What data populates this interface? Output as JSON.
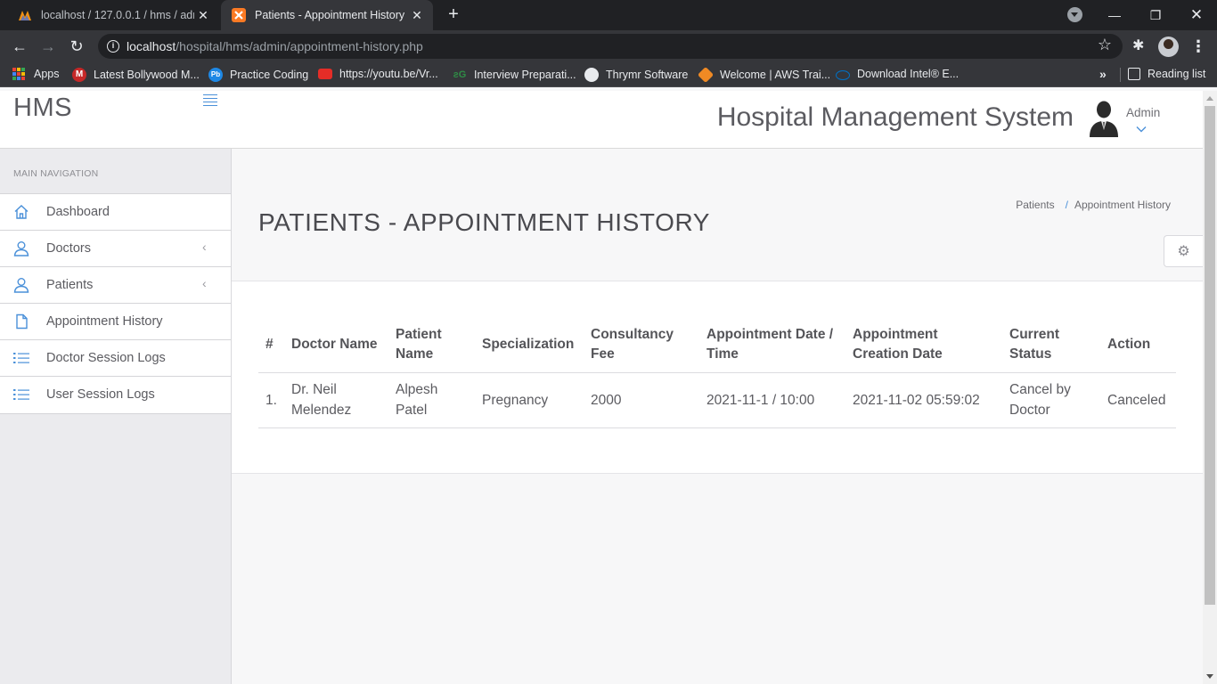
{
  "browser": {
    "tabs": [
      {
        "title": "localhost / 127.0.0.1 / hms / adm",
        "active": false
      },
      {
        "title": "Patients - Appointment History",
        "active": true
      }
    ],
    "url_host": "localhost",
    "url_path": "/hospital/hms/admin/appointment-history.php",
    "bookmarks": [
      {
        "label": "Apps",
        "icon": "apps-grid-icon"
      },
      {
        "label": "Latest Bollywood M...",
        "icon": "music-m-icon",
        "color": "#c62828"
      },
      {
        "label": "Practice Coding",
        "icon": "pb-icon",
        "color": "#1e88e5"
      },
      {
        "label": "https://youtu.be/Vr...",
        "icon": "youtube-icon",
        "color": "#e52d27"
      },
      {
        "label": "Interview Preparati...",
        "icon": "gfg-icon",
        "color": "#2f8d46"
      },
      {
        "label": "Thrymr Software",
        "icon": "globe-icon",
        "color": "#e8eaed"
      },
      {
        "label": "Welcome | AWS Trai...",
        "icon": "aws-icon",
        "color": "#f08a24"
      },
      {
        "label": "Download Intel® E...",
        "icon": "intel-icon",
        "color": "#0071c5"
      }
    ],
    "reading_list": "Reading list"
  },
  "app": {
    "brand": "HMS",
    "system_title": "Hospital Management System",
    "user": "Admin",
    "accent": "#4a90d9"
  },
  "sidebar": {
    "section_title": "MAIN NAVIGATION",
    "items": [
      {
        "label": "Dashboard",
        "icon": "home-icon",
        "has_submenu": false
      },
      {
        "label": "Doctors",
        "icon": "user-icon",
        "has_submenu": true
      },
      {
        "label": "Patients",
        "icon": "user-icon",
        "has_submenu": true
      },
      {
        "label": "Appointment History",
        "icon": "file-icon",
        "has_submenu": false
      },
      {
        "label": "Doctor Session Logs",
        "icon": "list-icon",
        "has_submenu": false
      },
      {
        "label": "User Session Logs",
        "icon": "list-icon",
        "has_submenu": false
      }
    ]
  },
  "page": {
    "title": "PATIENTS - APPOINTMENT HISTORY",
    "breadcrumb": [
      "Patients",
      "Appointment History"
    ]
  },
  "table": {
    "headers": {
      "num": "#",
      "doctor_name": "Doctor Name",
      "patient_name": "Patient Name",
      "specialization": "Specialization",
      "fee": "Consultancy Fee",
      "appt_datetime": "Appointment Date / Time",
      "created": "Appointment Creation Date",
      "status": "Current Status",
      "action": "Action"
    },
    "rows": [
      {
        "num": "1.",
        "doctor_name": "Dr. Neil Melendez",
        "patient_name": "Alpesh Patel",
        "specialization": "Pregnancy",
        "fee": "2000",
        "appt_datetime": "2021-11-1 / 10:00",
        "created": "2021-11-02 05:59:02",
        "status": "Cancel by Doctor",
        "action": "Canceled"
      }
    ]
  }
}
